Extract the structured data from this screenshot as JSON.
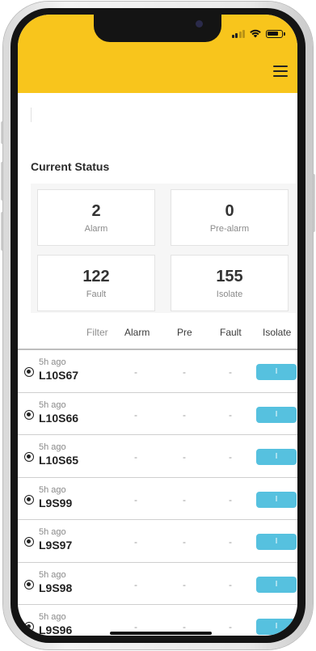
{
  "status_bar": {
    "icons": [
      "signal-icon",
      "wifi-icon",
      "battery-icon"
    ]
  },
  "header": {
    "background": "#f8c51c",
    "menu_icon": "hamburger-menu-icon"
  },
  "current_status": {
    "title": "Current Status",
    "cards": [
      {
        "value": "2",
        "label": "Alarm"
      },
      {
        "value": "0",
        "label": "Pre-alarm"
      },
      {
        "value": "122",
        "label": "Fault"
      },
      {
        "value": "155",
        "label": "Isolate"
      }
    ]
  },
  "table": {
    "columns": [
      "Filter",
      "Alarm",
      "Pre",
      "Fault",
      "Isolate"
    ],
    "rows": [
      {
        "time": "5h ago",
        "code": "L10S67",
        "alarm": "-",
        "pre": "-",
        "fault": "-",
        "isolate": "I"
      },
      {
        "time": "5h ago",
        "code": "L10S66",
        "alarm": "-",
        "pre": "-",
        "fault": "-",
        "isolate": "I"
      },
      {
        "time": "5h ago",
        "code": "L10S65",
        "alarm": "-",
        "pre": "-",
        "fault": "-",
        "isolate": "I"
      },
      {
        "time": "5h ago",
        "code": "L9S99",
        "alarm": "-",
        "pre": "-",
        "fault": "-",
        "isolate": "I"
      },
      {
        "time": "5h ago",
        "code": "L9S97",
        "alarm": "-",
        "pre": "-",
        "fault": "-",
        "isolate": "I"
      },
      {
        "time": "5h ago",
        "code": "L9S98",
        "alarm": "-",
        "pre": "-",
        "fault": "-",
        "isolate": "I"
      },
      {
        "time": "5h ago",
        "code": "L9S96",
        "alarm": "-",
        "pre": "-",
        "fault": "-",
        "isolate": "I"
      }
    ],
    "isolate_button_color": "#56c1df"
  }
}
